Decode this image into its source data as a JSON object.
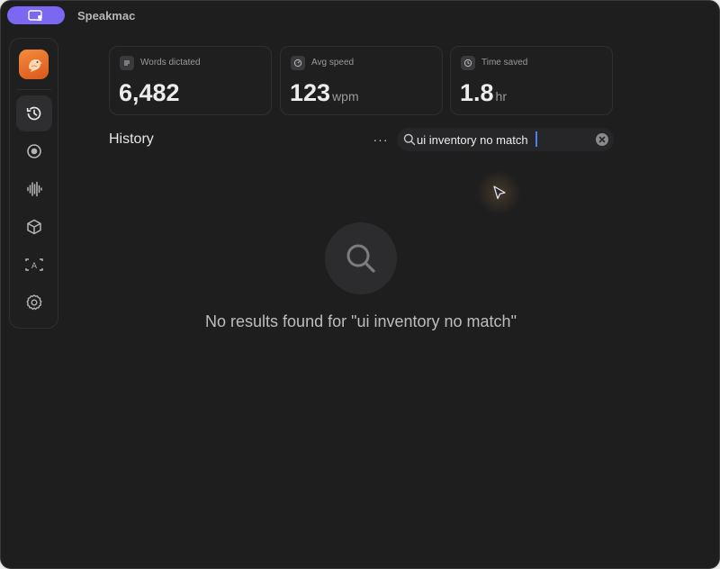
{
  "app": {
    "title": "Speakmac"
  },
  "stats": [
    {
      "label": "Words dictated",
      "value": "6,482",
      "unit": "",
      "icon": "document-icon"
    },
    {
      "label": "Avg speed",
      "value": "123",
      "unit": "wpm",
      "icon": "speedometer-icon"
    },
    {
      "label": "Time saved",
      "value": "1.8",
      "unit": "hr",
      "icon": "clock-icon"
    }
  ],
  "sidebar": {
    "items": [
      {
        "name": "history",
        "icon": "history-icon",
        "active": true
      },
      {
        "name": "record",
        "icon": "record-icon",
        "active": false
      },
      {
        "name": "audio",
        "icon": "waveform-icon",
        "active": false
      },
      {
        "name": "models",
        "icon": "cube-icon",
        "active": false
      },
      {
        "name": "text",
        "icon": "text-box-icon",
        "active": false
      },
      {
        "name": "settings",
        "icon": "gear-icon",
        "active": false
      }
    ]
  },
  "history": {
    "title": "History",
    "more_label": "···",
    "search": {
      "value": "ui inventory no match",
      "placeholder": ""
    },
    "empty_message": "No results found for \"ui inventory no match\""
  },
  "colors": {
    "accent": "#7a67f2",
    "background": "#1e1e1f",
    "logo": "#e8702a"
  }
}
